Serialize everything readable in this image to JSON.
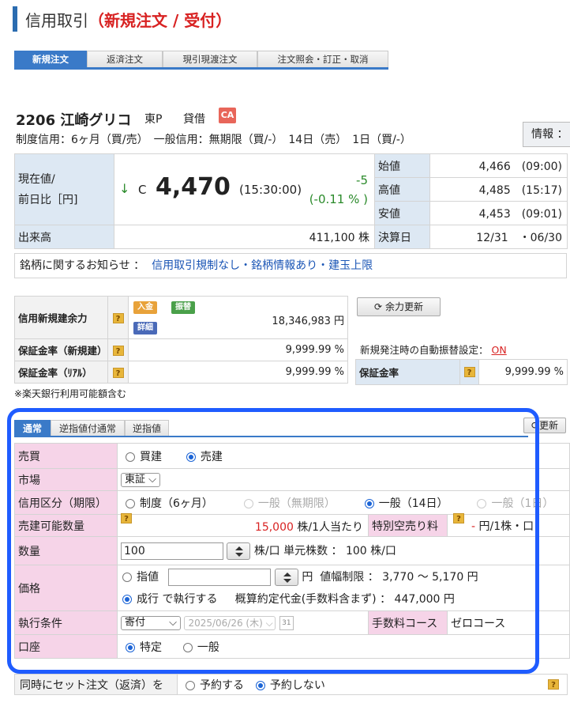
{
  "header": {
    "title_main": "信用取引",
    "title_sub": "（新規注文 / 受付）"
  },
  "tabs": [
    {
      "label": "新規注文",
      "active": true
    },
    {
      "label": "返済注文",
      "active": false
    },
    {
      "label": "現引現渡注文",
      "active": false
    },
    {
      "label": "注文照会・訂正・取消",
      "active": false
    }
  ],
  "stock": {
    "code_name": "2206 江崎グリコ",
    "market": "東P",
    "taishaku": "貸借",
    "badge": "CA",
    "credit_info": "制度信用：6ヶ月（買/売）　一般信用：無期限（買/-）　14日（売）　1日（買/-）",
    "info_button": "情報 ："
  },
  "price": {
    "label_line1": "現在値/",
    "label_line2": "前日比［円]",
    "arrow": "↓",
    "flag": "C",
    "current": "4,470",
    "time": "(15:30:00)",
    "change": "-5",
    "change_pct": "(-0.11 % )",
    "open_label": "始値",
    "open_value": "4,466　(09:00)",
    "high_label": "高値",
    "high_value": "4,485　(15:17)",
    "low_label": "安値",
    "low_value": "4,453　(09:01)",
    "volume_label": "出来高",
    "volume_value": "411,100 株",
    "settle_label": "決算日",
    "settle_value": "12/31　・06/30"
  },
  "notice": {
    "label": "銘柄に関するお知らせ ：",
    "links": "信用取引規制なし・銘柄情報あり・建玉上限"
  },
  "margin": {
    "row1_label": "信用新規建余力",
    "btn_deposit": "入金",
    "btn_transfer": "振替",
    "btn_detail": "詳細",
    "row1_value": "18,346,983 円",
    "row2_label": "保証金率（新規建）",
    "row2_value": "9,999.99 %",
    "row3_label": "保証金率（ﾘｱﾙ）",
    "row3_value": "9,999.99 %",
    "refresh_button": "余力更新",
    "auto_transfer_label": "新規発注時の自動振替設定：",
    "auto_transfer_value": "ON",
    "right_rate_label": "保証金率",
    "right_rate_value": "9,999.99 %",
    "note": "※楽天銀行利用可能額含む"
  },
  "order_tabs": [
    {
      "label": "通常",
      "active": true
    },
    {
      "label": "逆指値付通常",
      "active": false
    },
    {
      "label": "逆指値",
      "active": false
    }
  ],
  "update_button": "更新",
  "form": {
    "side_label": "売買",
    "buy": "買建",
    "sell": "売建",
    "market_label": "市場",
    "market_value": "東証",
    "credit_label": "信用区分（期限）",
    "credit_opt1": "制度（6ヶ月）",
    "credit_opt2": "一般（無期限）",
    "credit_opt3": "一般（14日）",
    "credit_opt4": "一般（1日）",
    "sellable_label": "売建可能数量",
    "sellable_value": "15,000",
    "sellable_unit": "株/1人当たり",
    "special_label": "特別空売り料",
    "special_value": "-",
    "special_unit": "円/1株・口",
    "qty_label": "数量",
    "qty_value": "100",
    "qty_unit": "株/口",
    "unit_shares": "単元株数 ：  100 株/口",
    "price_label": "価格",
    "limit_label": "指値",
    "yen": "円",
    "range_text": "値幅制限 ：  3,770 〜 5,170 円",
    "market_order_label": "成行",
    "market_order_suffix": "で執行する",
    "estimate_text": "概算約定代金(手数料含まず) ：  447,000 円",
    "cond_label": "執行条件",
    "cond_value": "寄付",
    "date_value": "2025/06/26 (木)",
    "fee_label": "手数料コース",
    "fee_value": "ゼロコース",
    "account_label": "口座",
    "account_opt1": "特定",
    "account_opt2": "一般",
    "calendar_icon_text": "31"
  },
  "set_order": {
    "label": "同時にセット注文（返済）を",
    "yes": "予約する",
    "no": "予約しない"
  }
}
